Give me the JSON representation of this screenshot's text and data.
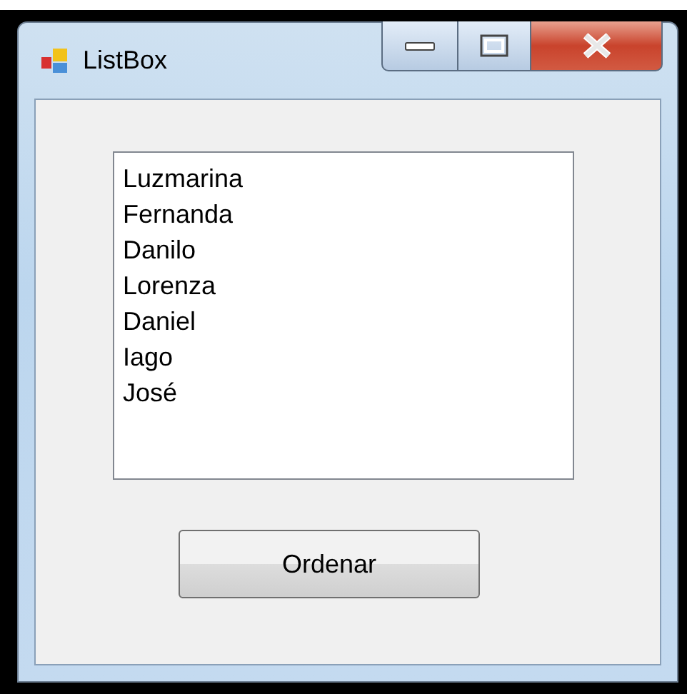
{
  "window": {
    "title": "ListBox"
  },
  "listbox": {
    "items": [
      "Luzmarina",
      "Fernanda",
      "Danilo",
      "Lorenza",
      "Daniel",
      "Iago",
      "José"
    ]
  },
  "buttons": [
    "Ordenar"
  ]
}
